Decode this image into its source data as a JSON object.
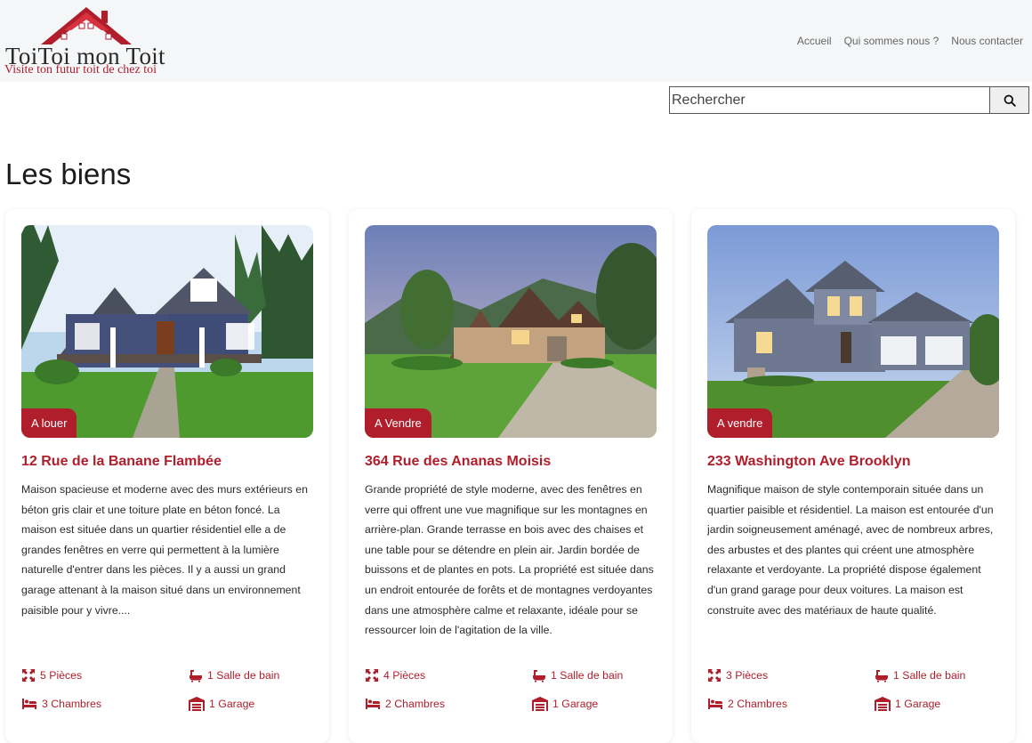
{
  "header": {
    "logo": {
      "title": "ToiToi mon Toit",
      "tagline": "Visite ton futur toit de chez toi"
    },
    "nav": [
      {
        "label": "Accueil"
      },
      {
        "label": "Qui sommes nous ?"
      },
      {
        "label": "Nous contacter"
      }
    ]
  },
  "search": {
    "placeholder": "Rechercher",
    "value": "",
    "icon": "search-icon"
  },
  "main": {
    "title": "Les biens"
  },
  "listings": [
    {
      "badge": "A louer",
      "title": "12 Rue de la Banane Flambée",
      "description": "Maison spacieuse et moderne avec des murs extérieurs en béton gris clair et une toiture plate en béton foncé. La maison est située dans un quartier résidentiel elle a de grandes fenêtres en verre qui permettent à la lumière naturelle d'entrer dans les pièces. Il y a aussi un grand garage attenant à la maison situé dans un environnement paisible pour y vivre....",
      "features": {
        "rooms": "5 Pièces",
        "bathrooms": "1 Salle de bain",
        "bedrooms": "3 Chambres",
        "garage": "1 Garage"
      }
    },
    {
      "badge": "A Vendre",
      "title": "364 Rue des Ananas Moisis",
      "description": "Grande propriété de style moderne, avec des fenêtres en verre qui offrent une vue magnifique sur les montagnes en arrière-plan. Grande terrasse en bois avec des chaises et une table pour se détendre en plein air. Jardin bordée de buissons et de plantes en pots. La propriété est située dans un endroit entourée de forêts et de montagnes verdoyantes dans une atmosphère calme et relaxante, idéale pour se ressourcer loin de l'agitation de la ville.",
      "features": {
        "rooms": "4 Pièces",
        "bathrooms": "1 Salle de bain",
        "bedrooms": "2 Chambres",
        "garage": "1 Garage"
      }
    },
    {
      "badge": "A vendre",
      "title": "233 Washington Ave Brooklyn",
      "description": "Magnifique maison de style contemporain située dans un quartier paisible et résidentiel. La maison est entourée d'un jardin soigneusement aménagé, avec de nombreux arbres, des arbustes et des plantes qui créent une atmosphère relaxante et verdoyante. La propriété dispose également d'un grand garage pour deux voitures. La maison est construite avec des matériaux de haute qualité.",
      "features": {
        "rooms": "3 Pièces",
        "bathrooms": "1 Salle de bain",
        "bedrooms": "2 Chambres",
        "garage": "1 Garage"
      }
    }
  ],
  "colors": {
    "accent": "#b01e2c",
    "header_bg": "#f5f6f7",
    "text": "#2a2a2a"
  },
  "icons": {
    "rooms": "expand-arrows-icon",
    "bathrooms": "bathtub-icon",
    "bedrooms": "bed-icon",
    "garage": "garage-icon"
  }
}
